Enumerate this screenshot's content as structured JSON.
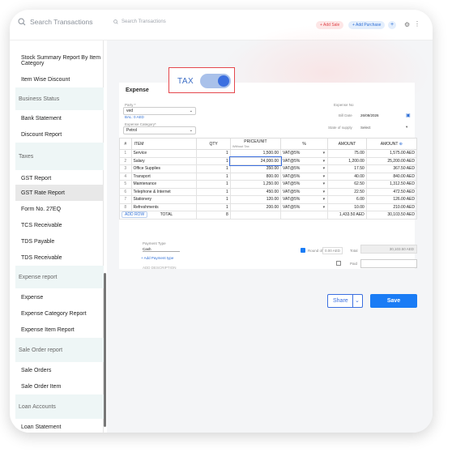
{
  "topbar": {
    "sidebar_search": "Search Transactions",
    "main_search": "Search Transactions",
    "add_sale": "+ Add Sale",
    "add_purchase": "+ Add Purchase",
    "plus": "+",
    "gear": "⚙",
    "more": "⋮"
  },
  "sidebar": {
    "items": [
      {
        "label": "Stock Summary Report By Item Category",
        "kind": "item"
      },
      {
        "label": "Item Wise Discount",
        "kind": "item"
      },
      {
        "label": "Business Status",
        "kind": "section"
      },
      {
        "label": "Bank Statement",
        "kind": "item"
      },
      {
        "label": "Discount Report",
        "kind": "item"
      },
      {
        "label": "Taxes",
        "kind": "section"
      },
      {
        "label": "GST Report",
        "kind": "item"
      },
      {
        "label": "GST Rate Report",
        "kind": "item",
        "active": true
      },
      {
        "label": "Form No. 27EQ",
        "kind": "item"
      },
      {
        "label": "TCS Receivable",
        "kind": "item"
      },
      {
        "label": "TDS Payable",
        "kind": "item"
      },
      {
        "label": "TDS Receivable",
        "kind": "item"
      },
      {
        "label": "Expense report",
        "kind": "section"
      },
      {
        "label": "Expense",
        "kind": "item"
      },
      {
        "label": "Expense Category Report",
        "kind": "item"
      },
      {
        "label": "Expense Item Report",
        "kind": "item"
      },
      {
        "label": "Sale Order report",
        "kind": "section"
      },
      {
        "label": "Sale Orders",
        "kind": "item"
      },
      {
        "label": "Sale Order Item",
        "kind": "item"
      },
      {
        "label": "Loan Accounts",
        "kind": "section"
      },
      {
        "label": "Loan Statement",
        "kind": "item"
      }
    ]
  },
  "form": {
    "title": "Expense",
    "tax_label": "TAX",
    "tax_enabled": true,
    "party_label": "Party *",
    "party_value": "ved",
    "balance": "BAL: 0 AED",
    "category_label": "Expense Category*",
    "category_value": "Petrol",
    "expense_no_label": "Expense No",
    "bill_date_label": "Bill Date",
    "bill_date_value": "26/08/2026",
    "state_label": "State of supply",
    "state_value": "Select"
  },
  "table": {
    "headers": {
      "idx": "#",
      "item": "ITEM",
      "qty": "QTY",
      "price": "PRICE/UNIT",
      "price_sub": "Without Tax",
      "tax": "%",
      "amount_tax": "AMOUNT",
      "amount": "AMOUNT"
    },
    "rows": [
      {
        "idx": "1",
        "item": "Service",
        "qty": "1",
        "price": "1,500.00",
        "tax": "VAT@5%",
        "tax_amt": "75.00",
        "amount": "1,575.00 AED"
      },
      {
        "idx": "2",
        "item": "Salary",
        "qty": "1",
        "price": "24,000.00",
        "tax": "VAT@5%",
        "tax_amt": "1,200.00",
        "amount": "25,200.00 AED"
      },
      {
        "idx": "3",
        "item": "Office Supplies",
        "qty": "1",
        "price": "350.00",
        "tax": "VAT@5%",
        "tax_amt": "17.50",
        "amount": "367.50 AED"
      },
      {
        "idx": "4",
        "item": "Transport",
        "qty": "1",
        "price": "800.00",
        "tax": "VAT@5%",
        "tax_amt": "40.00",
        "amount": "840.00 AED"
      },
      {
        "idx": "5",
        "item": "Maintenance",
        "qty": "1",
        "price": "1,250.00",
        "tax": "VAT@5%",
        "tax_amt": "62.50",
        "amount": "1,312.50 AED"
      },
      {
        "idx": "6",
        "item": "Telephone & Internet",
        "qty": "1",
        "price": "450.00",
        "tax": "VAT@5%",
        "tax_amt": "22.50",
        "amount": "472.50 AED"
      },
      {
        "idx": "7",
        "item": "Stationery",
        "qty": "1",
        "price": "120.00",
        "tax": "VAT@5%",
        "tax_amt": "6.00",
        "amount": "126.00 AED"
      },
      {
        "idx": "8",
        "item": "Refreshments",
        "qty": "1",
        "price": "200.00",
        "tax": "VAT@5%",
        "tax_amt": "10.00",
        "amount": "210.00 AED"
      }
    ],
    "add_row": "ADD ROW",
    "total_label": "TOTAL",
    "total_qty": "8",
    "total_tax": "1,433.50 AED",
    "total_amount": "30,103.50 AED"
  },
  "bottom": {
    "payment_type_label": "Payment Type",
    "payment_type_value": "Cash",
    "add_payment": "+ Add Payment type",
    "add_description": "ADD DESCRIPTION",
    "round_off_label": "Round off",
    "round_off_value": "0.00 AED",
    "total_label": "Total",
    "total_value": "30,103.50 AED",
    "paid_label": "Paid"
  },
  "actions": {
    "share": "Share",
    "save": "Save"
  }
}
